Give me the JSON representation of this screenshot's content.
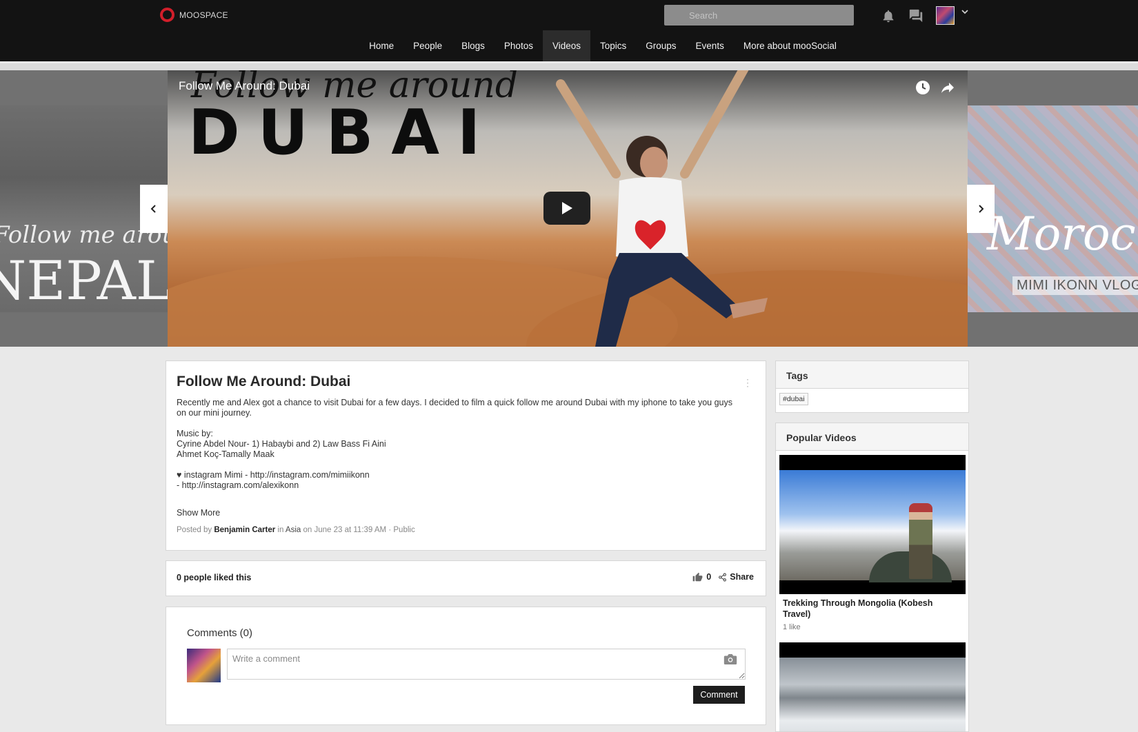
{
  "brand": {
    "name": "MOOSPACE",
    "accent": "#d11e2a"
  },
  "search": {
    "placeholder": "Search"
  },
  "nav": {
    "items": [
      {
        "label": "Home"
      },
      {
        "label": "People"
      },
      {
        "label": "Blogs"
      },
      {
        "label": "Photos"
      },
      {
        "label": "Videos",
        "active": true
      },
      {
        "label": "Topics"
      },
      {
        "label": "Groups"
      },
      {
        "label": "Events"
      },
      {
        "label": "More about mooSocial"
      }
    ]
  },
  "header_icons": [
    "bell-icon",
    "chat-icon",
    "avatar",
    "chevron-down-icon"
  ],
  "slider": {
    "left": {
      "script": "Follow me around",
      "big": "NEPAL"
    },
    "current": {
      "title": "Follow Me Around: Dubai",
      "script": "Follow me around",
      "big": "DUBAI"
    },
    "right": {
      "script": "Moroc",
      "caption": "MIMI IKONN VLOG"
    }
  },
  "video": {
    "title": "Follow Me Around: Dubai",
    "description": [
      "Recently me and Alex got a chance to visit Dubai for a few days. I decided to film a quick follow me around Dubai with my iphone to take you guys on our mini journey.",
      "Music by:\nCyrine Abdel Nour- 1) Habaybi and 2) Law Bass Fi Aini\nAhmet Koç-Tamally Maak",
      "♥ instagram Mimi - http://instagram.com/mimiikonn\n- http://instagram.com/alexikonn"
    ],
    "show_more": "Show More",
    "meta": {
      "posted_by_label": "Posted by",
      "author": "Benjamin Carter",
      "in_label": "in",
      "category": "Asia",
      "date": "on June 23 at 11:39 AM",
      "separator": "·",
      "privacy": "Public"
    }
  },
  "likes": {
    "text": "0 people liked this",
    "count": "0",
    "share_label": "Share"
  },
  "comments": {
    "title": "Comments (0)",
    "placeholder": "Write a comment",
    "button": "Comment"
  },
  "tags_widget": {
    "title": "Tags",
    "tags": [
      "#dubai"
    ]
  },
  "popular_widget": {
    "title": "Popular Videos",
    "items": [
      {
        "title": "Trekking Through Mongolia (Kobesh Travel)",
        "likes": "1 like"
      }
    ]
  }
}
